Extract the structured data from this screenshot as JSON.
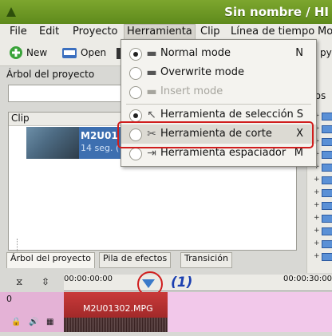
{
  "window": {
    "title": "Sin nombre / HI"
  },
  "menubar": [
    "File",
    "Edit",
    "Proyecto",
    "Herramienta",
    "Clip",
    "Línea de tiempo",
    "Mo"
  ],
  "toolbar": {
    "new_label": "New",
    "open_label": "Open",
    "right_partial": "py"
  },
  "project_panel": {
    "title": "Árbol del proyecto",
    "column_clip": "Clip",
    "right_partial": "dos"
  },
  "clip": {
    "name": "M2U01",
    "duration": "14 seg. ("
  },
  "bottom_tabs": [
    "Árbol del proyecto",
    "Pila de efectos",
    "Transición"
  ],
  "timeline": {
    "time_start": "00:00:00:00",
    "time_end": "00:00:30:00",
    "track_number": "0",
    "clip_name": "M2U01302.MPG",
    "annotation": "(1)"
  },
  "tool_menu": {
    "items": [
      {
        "label": "Normal mode",
        "shortcut": "N",
        "radio": true,
        "checked": true,
        "enabled": true,
        "icon": "normal-mode-icon"
      },
      {
        "label": "Overwrite mode",
        "shortcut": "",
        "radio": true,
        "checked": false,
        "enabled": true,
        "icon": "overwrite-mode-icon"
      },
      {
        "label": "Insert mode",
        "shortcut": "",
        "radio": true,
        "checked": false,
        "enabled": false,
        "icon": "insert-mode-icon"
      },
      {
        "label": "Herramienta de selección",
        "shortcut": "S",
        "radio": true,
        "checked": true,
        "enabled": true,
        "icon": "cursor-icon"
      },
      {
        "label": "Herramienta de corte",
        "shortcut": "X",
        "radio": true,
        "checked": false,
        "enabled": true,
        "highlighted": true,
        "icon": "scissors-icon"
      },
      {
        "label": "Herramienta espaciador",
        "shortcut": "M",
        "radio": true,
        "checked": false,
        "enabled": true,
        "icon": "spacer-icon"
      }
    ]
  },
  "colors": {
    "title_bar": "#6e9a24",
    "highlight_box": "#d01e1e",
    "timeline_marker": "#3a79c9",
    "track_bg": "#f2c8ea"
  }
}
